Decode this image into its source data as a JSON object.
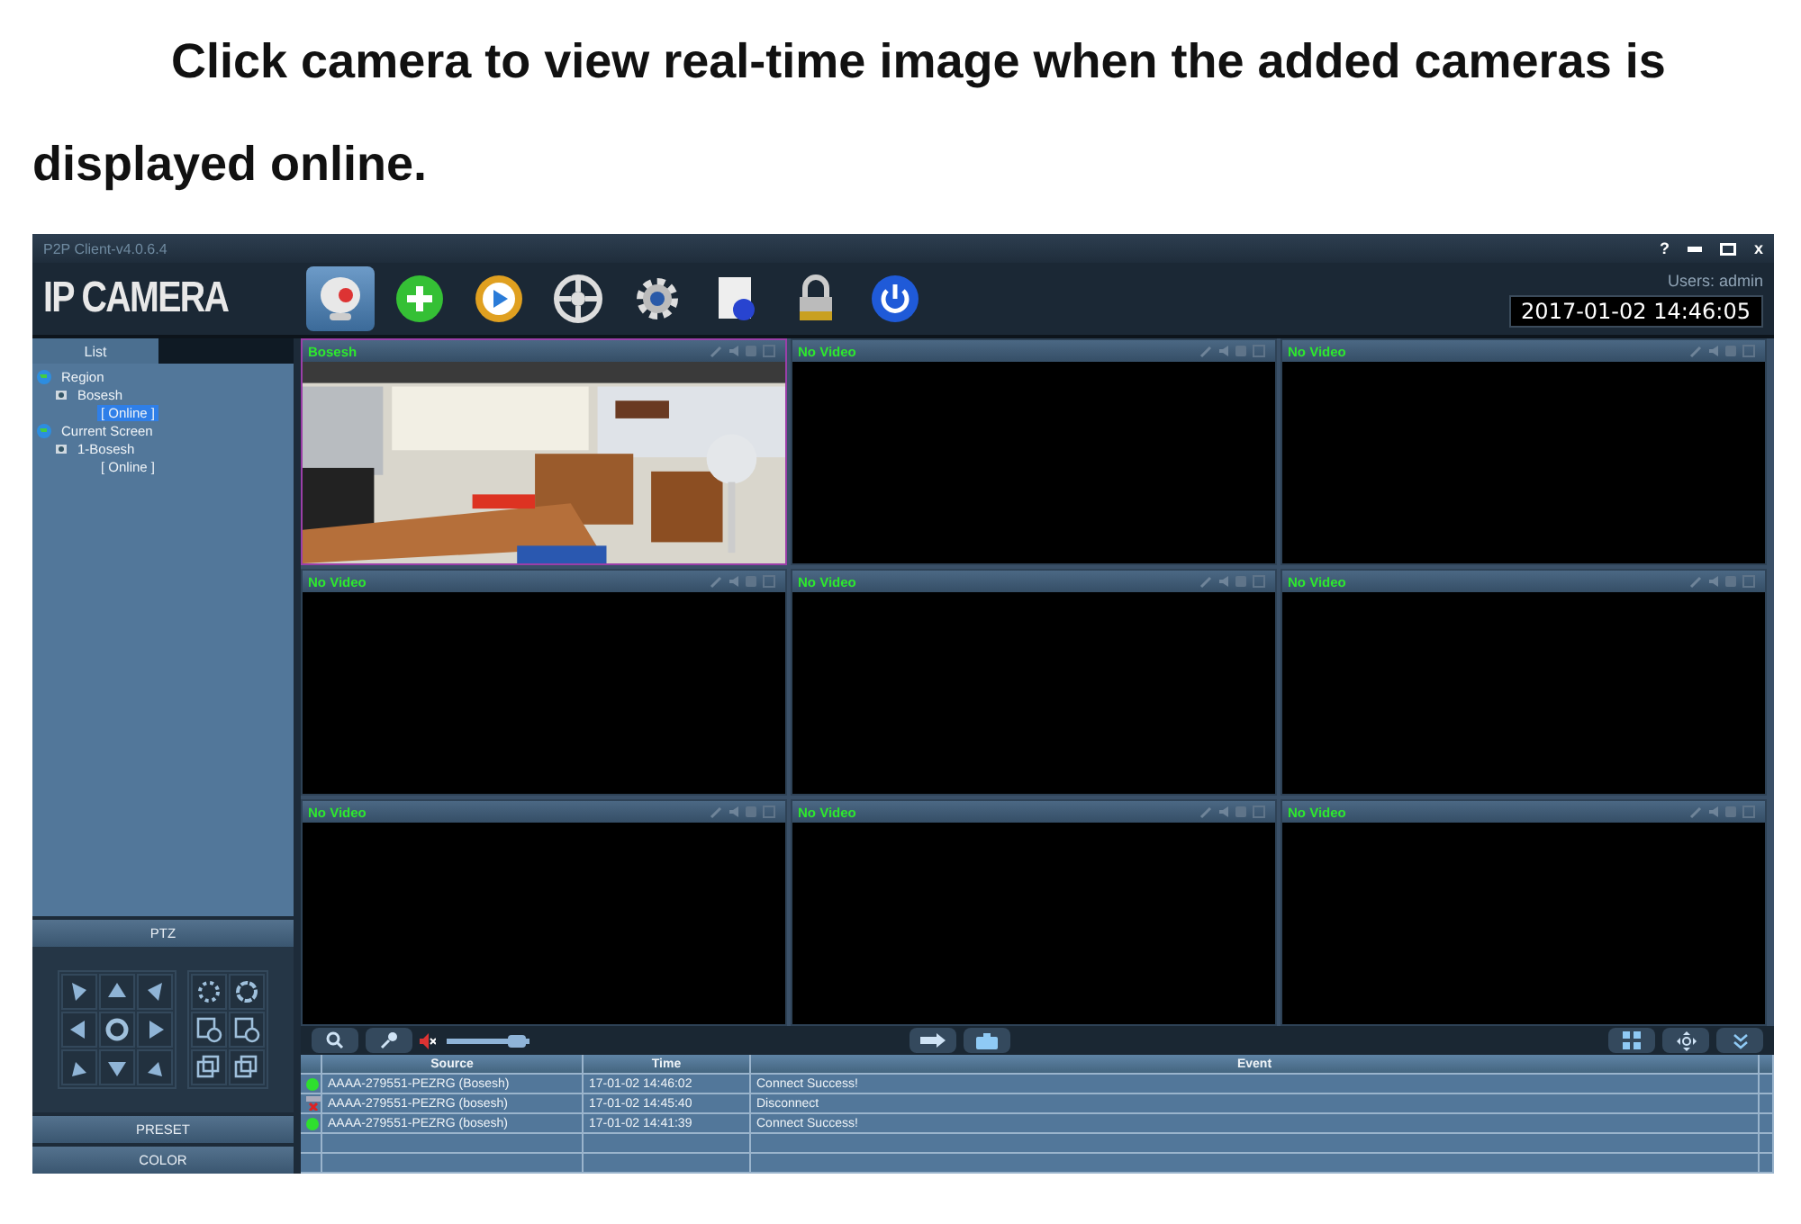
{
  "heading": "Click camera to view real-time image when the added cameras is displayed online.",
  "window": {
    "title": "P2P Client-v4.0.6.4",
    "controls": {
      "help": "?",
      "close": "x"
    }
  },
  "toolbar": {
    "logo": "IP CAMERA",
    "user": "Users: admin",
    "datetime": "2017-01-02 14:46:05",
    "buttons": [
      {
        "kind": "camera",
        "selected": true
      },
      {
        "kind": "add",
        "selected": false
      },
      {
        "kind": "play",
        "selected": false
      },
      {
        "kind": "wheel",
        "selected": false
      },
      {
        "kind": "gear",
        "selected": false
      },
      {
        "kind": "document",
        "selected": false
      },
      {
        "kind": "lock",
        "selected": false
      },
      {
        "kind": "power",
        "selected": false
      }
    ]
  },
  "sidebar": {
    "tab": "List",
    "tree": [
      {
        "label": "Region",
        "kind": "group",
        "selected": false,
        "children": [
          {
            "label": "Bosesh",
            "kind": "camera",
            "selected": false,
            "children": [
              {
                "label": "[  Online  ]",
                "kind": "status",
                "selected": true
              }
            ]
          }
        ]
      },
      {
        "label": "Current Screen",
        "kind": "group",
        "selected": false,
        "children": [
          {
            "label": "1-Bosesh",
            "kind": "camera",
            "selected": false,
            "children": [
              {
                "label": "[  Online  ]",
                "kind": "status",
                "selected": false
              }
            ]
          }
        ]
      }
    ],
    "sections": [
      "PTZ",
      "PRESET",
      "COLOR"
    ]
  },
  "video_cells": [
    {
      "title": "Bosesh",
      "kind": "picture",
      "selected": true
    },
    {
      "title": "No Video",
      "kind": "empty",
      "selected": false
    },
    {
      "title": "No Video",
      "kind": "empty",
      "selected": false
    },
    {
      "title": "No Video",
      "kind": "empty",
      "selected": false
    },
    {
      "title": "No Video",
      "kind": "empty",
      "selected": false
    },
    {
      "title": "No Video",
      "kind": "empty",
      "selected": false
    },
    {
      "title": "No Video",
      "kind": "empty",
      "selected": false
    },
    {
      "title": "No Video",
      "kind": "empty",
      "selected": false
    },
    {
      "title": "No Video",
      "kind": "empty",
      "selected": false
    }
  ],
  "volume": {
    "level": 0.85
  },
  "log": {
    "columns": [
      "Source",
      "Time",
      "Event"
    ],
    "rows": [
      {
        "kind": "online",
        "source": "AAAA-279551-PEZRG (Bosesh)",
        "time": "17-01-02 14:46:02",
        "event": "Connect Success!"
      },
      {
        "kind": "offline",
        "source": "AAAA-279551-PEZRG (bosesh)",
        "time": "17-01-02 14:45:40",
        "event": "Disconnect"
      },
      {
        "kind": "online",
        "source": "AAAA-279551-PEZRG (bosesh)",
        "time": "17-01-02 14:41:39",
        "event": "Connect Success!"
      }
    ]
  }
}
